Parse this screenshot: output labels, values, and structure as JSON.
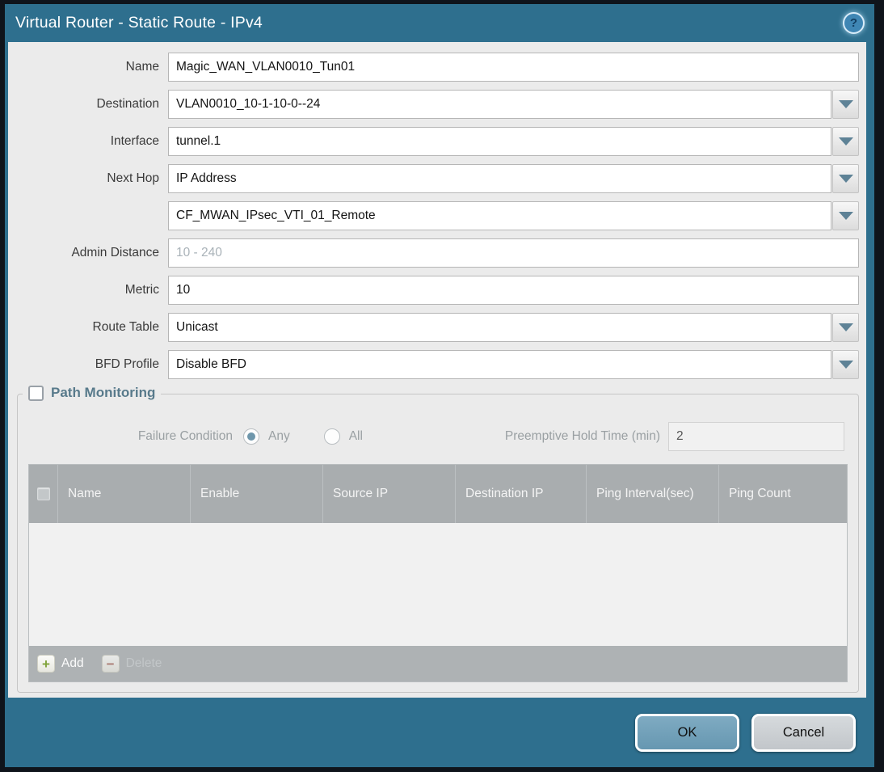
{
  "colors": {
    "titlebar": "#2e6f8e",
    "frame": "#0f141b",
    "content_bg": "#ebebeb",
    "table_header_bg": "#a9adaf",
    "ok_button": "#6fa0b9",
    "cancel_button": "#c9cdd1",
    "add_icon_green": "#7fa339",
    "delete_icon_red": "#a96a5e"
  },
  "titlebar": {
    "title": "Virtual Router - Static Route - IPv4",
    "help_glyph": "?"
  },
  "form": {
    "name": {
      "label": "Name",
      "value": "Magic_WAN_VLAN0010_Tun01"
    },
    "destination": {
      "label": "Destination",
      "value": "VLAN0010_10-1-10-0--24"
    },
    "interface": {
      "label": "Interface",
      "value": "tunnel.1"
    },
    "next_hop": {
      "label": "Next Hop",
      "value": "IP Address",
      "address_value": "CF_MWAN_IPsec_VTI_01_Remote"
    },
    "admin_distance": {
      "label": "Admin Distance",
      "placeholder": "10 - 240"
    },
    "metric": {
      "label": "Metric",
      "value": "10"
    },
    "route_table": {
      "label": "Route Table",
      "value": "Unicast"
    },
    "bfd_profile": {
      "label": "BFD Profile",
      "value": "Disable BFD"
    }
  },
  "path_monitoring": {
    "title": "Path Monitoring",
    "enabled": false,
    "failure_condition": {
      "label": "Failure Condition",
      "options": [
        "Any",
        "All"
      ],
      "selected": "Any"
    },
    "preemptive_hold_time": {
      "label": "Preemptive Hold Time (min)",
      "value": "2"
    },
    "table": {
      "columns": [
        "Name",
        "Enable",
        "Source IP",
        "Destination IP",
        "Ping Interval(sec)",
        "Ping Count"
      ],
      "rows": [],
      "add_label": "Add",
      "add_glyph": "+",
      "delete_label": "Delete",
      "delete_glyph": "−"
    }
  },
  "footer": {
    "ok_label": "OK",
    "cancel_label": "Cancel"
  }
}
